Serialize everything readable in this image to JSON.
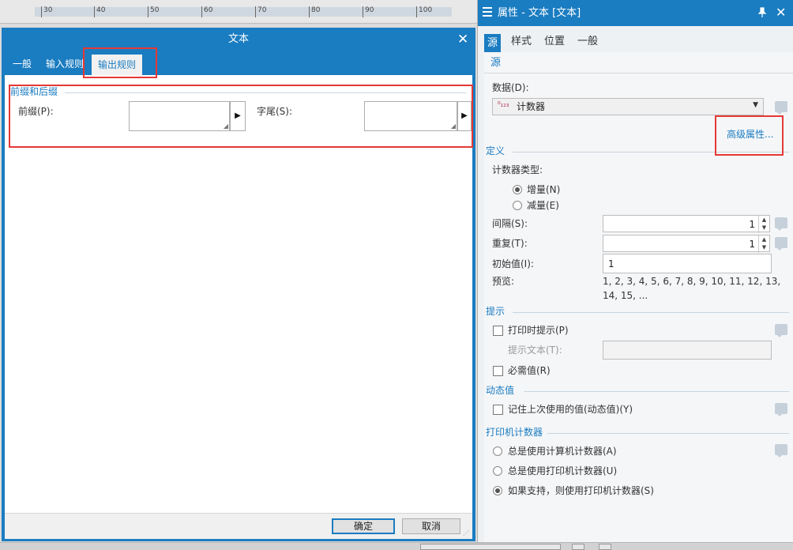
{
  "ruler": {
    "labels": [
      "30",
      "40",
      "50",
      "60",
      "70",
      "80",
      "90",
      "100"
    ]
  },
  "dialog": {
    "title": "文本",
    "close_glyph": "✕",
    "tabs": [
      "一般",
      "输入规则",
      "输出规则"
    ],
    "active_tab": "输出规则",
    "group_title": "前缀和后缀",
    "prefix_label": "前缀(P):",
    "suffix_label": "字尾(S):",
    "prefix_value": "",
    "suffix_value": "",
    "ok_label": "确定",
    "cancel_label": "取消"
  },
  "panel": {
    "title": "属性 - 文本 [文本]",
    "tabs": [
      "源",
      "样式",
      "位置",
      "一般"
    ],
    "active_tab": "源",
    "sub_tab": "源",
    "data_label": "数据(D):",
    "data_value": "计数器",
    "advanced_link": "高级属性...",
    "definition": {
      "title": "定义",
      "counter_type_label": "计数器类型:",
      "increment_label": "增量(N)",
      "decrement_label": "减量(E)",
      "selected": "增量(N)",
      "interval_label": "间隔(S):",
      "interval_value": "1",
      "repeat_label": "重复(T):",
      "repeat_value": "1",
      "initial_label": "初始值(I):",
      "initial_value": "1",
      "preview_label": "预览:",
      "preview_line1": "1, 2, 3, 4, 5, 6, 7, 8, 9, 10, 11, 12, 13,",
      "preview_line2": "14, 15, ..."
    },
    "prompt": {
      "title": "提示",
      "print_prompt_label": "打印时提示(P)",
      "prompt_text_label": "提示文本(T):",
      "prompt_text_value": "",
      "required_label": "必需值(R)"
    },
    "dynamic": {
      "title": "动态值",
      "remember_label": "记住上次使用的值(动态值)(Y)"
    },
    "printer_counter": {
      "title": "打印机计数器",
      "options": [
        "总是使用计算机计数器(A)",
        "总是使用打印机计数器(U)",
        "如果支持，则使用打印机计数器(S)"
      ],
      "selected": "如果支持，则使用打印机计数器(S)"
    }
  },
  "colors": {
    "accent": "#1a7cc1",
    "highlight": "#e53935"
  }
}
